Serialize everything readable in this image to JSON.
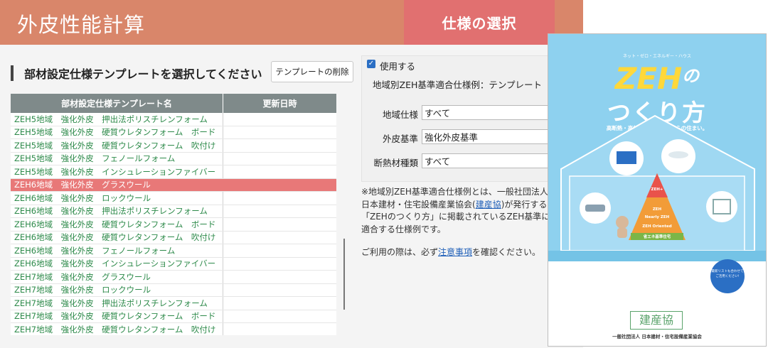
{
  "app": {
    "title": "外皮性能計算",
    "active_tab": "仕様の選択"
  },
  "template_section": {
    "heading": "部材設定仕様テンプレートを選択してください",
    "delete_button": "テンプレートの削除",
    "columns": [
      "部材設定仕様テンプレート名",
      "更新日時"
    ],
    "selected_index": 5,
    "rows": [
      "ZEH5地域　強化外皮　押出法ポリスチレンフォーム",
      "ZEH5地域　強化外皮　硬質ウレタンフォーム　ボード",
      "ZEH5地域　強化外皮　硬質ウレタンフォーム　吹付け",
      "ZEH5地域　強化外皮　フェノールフォーム",
      "ZEH5地域　強化外皮　インシュレーションファイバー",
      "ZEH6地域　強化外皮　グラスウール",
      "ZEH6地域　強化外皮　ロックウール",
      "ZEH6地域　強化外皮　押出法ポリスチレンフォーム",
      "ZEH6地域　強化外皮　硬質ウレタンフォーム　ボード",
      "ZEH6地域　強化外皮　硬質ウレタンフォーム　吹付け",
      "ZEH6地域　強化外皮　フェノールフォーム",
      "ZEH6地域　強化外皮　インシュレーションファイバー",
      "ZEH7地域　強化外皮　グラスウール",
      "ZEH7地域　強化外皮　ロックウール",
      "ZEH7地域　強化外皮　押出法ポリスチレンフォーム",
      "ZEH7地域　強化外皮　硬質ウレタンフォーム　ボード",
      "ZEH7地域　強化外皮　硬質ウレタンフォーム　吹付け"
    ]
  },
  "spec_panel": {
    "use_label": "使用する",
    "use_checked": true,
    "subtitle": "地域別ZEH基準適合仕様例：テンプレート",
    "fields": [
      {
        "label": "地域仕様",
        "value": "すべて"
      },
      {
        "label": "外皮基準",
        "value": "強化外皮基準"
      },
      {
        "label": "断熱材種類",
        "value": "すべて"
      }
    ]
  },
  "note": {
    "part1": "※地域別ZEH基準適合仕様例とは、一般社団法人日本建材・住宅設備産業協会(",
    "link": "建産協",
    "part2": ")が発行する「ZEHのつくり方」に掲載されているZEH基準に適合する仕様例です。"
  },
  "usage": {
    "prefix": "ご利用の際は、必ず",
    "link": "注意事項",
    "suffix": "を確認ください。"
  },
  "brochure": {
    "kana": "ネット・ゼロ・エネルギー・ハウス",
    "zeh": "ZEH",
    "no": "の",
    "tsukuri": "つくり方",
    "subtitle": "高断熱・高効率設備のこれからの住まい。",
    "pyramid": [
      "ZEH+",
      "ZEH",
      "Nearly ZEH",
      "ZEH Oriented",
      "省エネ基準住宅"
    ],
    "list_card": "最新リストも合わせてご活用ください!",
    "logo": "建産協",
    "association": "一般社団法人 日本建材・住宅設備産業協会"
  }
}
